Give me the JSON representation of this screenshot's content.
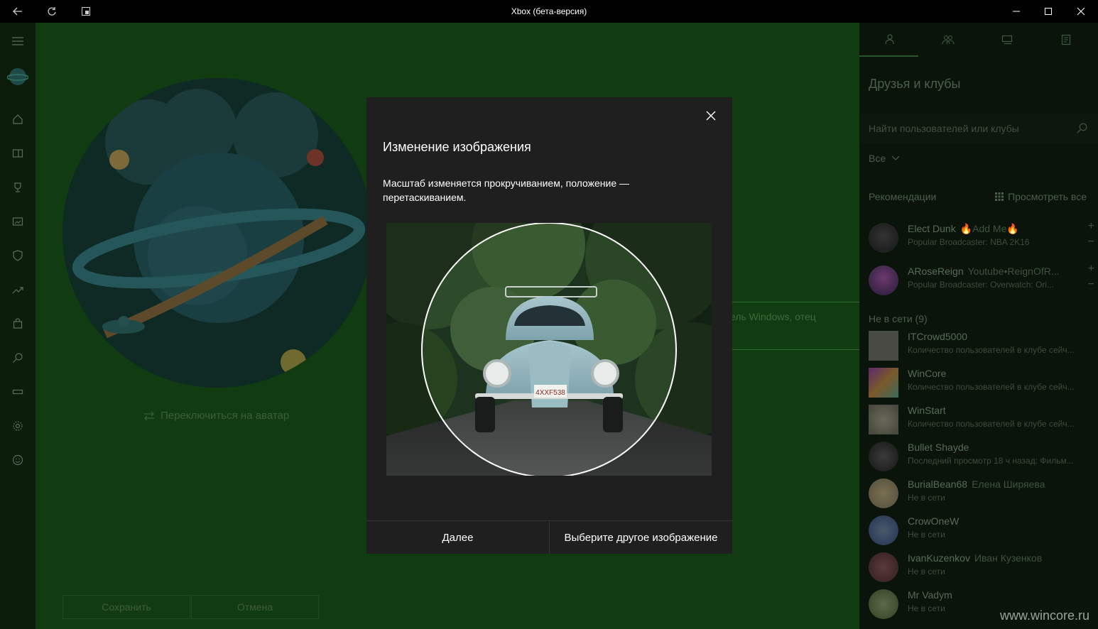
{
  "window": {
    "title": "Xbox (бета-версия)"
  },
  "main": {
    "switch_link": "Переключиться на аватар",
    "bio_field_text": "ель Windows, отец",
    "save_label": "Сохранить",
    "cancel_label": "Отмена"
  },
  "dialog": {
    "title": "Изменение изображения",
    "description": "Масштаб изменяется прокручиванием, положение — перетаскиванием.",
    "plate_text": "4XXF538",
    "next_label": "Далее",
    "choose_other_label": "Выберите другое изображение"
  },
  "right_panel": {
    "heading": "Друзья и клубы",
    "search_placeholder": "Найти пользователей или клубы",
    "filter_label": "Все",
    "recommendations_label": "Рекомендации",
    "view_all_label": "Просмотреть все",
    "online_label": "Не в сети (9)",
    "recommendations": [
      {
        "name": "Elect Dunk",
        "extra": "🔥Add Me🔥",
        "sub": "Popular Broadcaster: NBA 2K16"
      },
      {
        "name": "ARoseReign",
        "extra": "Youtube•ReignOfR...",
        "sub": "Popular Broadcaster: Overwatch: Ori..."
      }
    ],
    "friends": [
      {
        "name": "ITCrowd5000",
        "extra": "",
        "sub": "Количество пользователей в клубе сейч..."
      },
      {
        "name": "WinCore",
        "extra": "",
        "sub": "Количество пользователей в клубе сейч..."
      },
      {
        "name": "WinStart",
        "extra": "",
        "sub": "Количество пользователей в клубе сейч..."
      },
      {
        "name": "Bullet Shayde",
        "extra": "",
        "sub": "Последний просмотр 18 ч назад: Фильм..."
      },
      {
        "name": "BurialBean68",
        "extra": "Елена Ширяева",
        "sub": "Не в сети"
      },
      {
        "name": "CrowOneW",
        "extra": "",
        "sub": "Не в сети"
      },
      {
        "name": "IvanKuzenkov",
        "extra": "Иван Кузенков",
        "sub": "Не в сети"
      },
      {
        "name": "Mr Vadym",
        "extra": "",
        "sub": "Не в сети"
      }
    ]
  },
  "watermark": "www.wincore.ru",
  "colors": {
    "app_green": "#113b11",
    "dialog_bg": "#1f1f1f",
    "panel_bg": "#0b140b"
  }
}
